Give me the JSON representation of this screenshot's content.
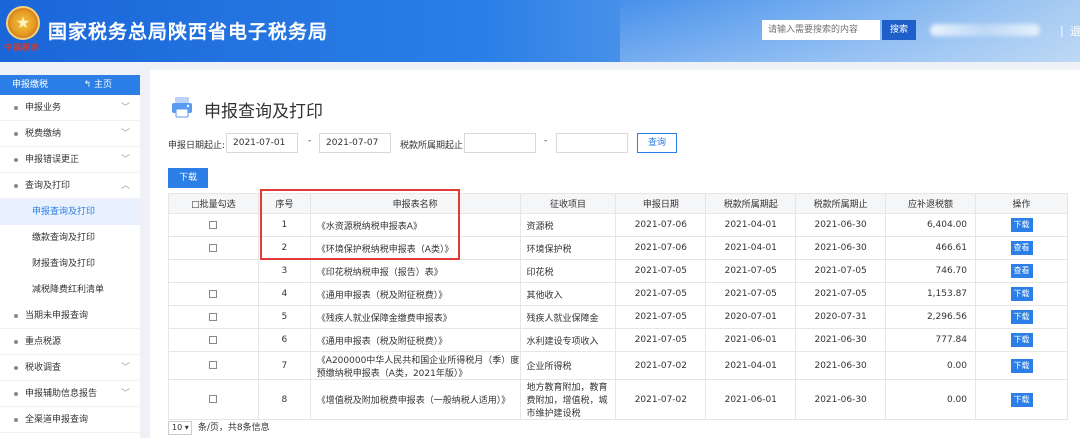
{
  "header": {
    "site_title": "国家税务总局陕西省电子税务局",
    "emblem_text": "中国税务",
    "search_placeholder": "请输入需要搜索的内容",
    "search_button": "搜索",
    "separator": "|",
    "tail_text": "退"
  },
  "sidebar": {
    "head_title": "申报缴税",
    "home_label": "主页",
    "items": [
      {
        "label": "申报业务",
        "chev": "﹀"
      },
      {
        "label": "税费缴纳",
        "chev": "﹀"
      },
      {
        "label": "申报错误更正",
        "chev": "﹀"
      },
      {
        "label": "查询及打印",
        "chev": "︿"
      }
    ],
    "subitems": [
      {
        "label": "申报查询及打印"
      },
      {
        "label": "缴款查询及打印"
      },
      {
        "label": "财报查询及打印"
      },
      {
        "label": "减税降费红利清单"
      }
    ],
    "items_after": [
      {
        "label": "当期未申报查询",
        "chev": ""
      },
      {
        "label": "重点税源",
        "chev": ""
      },
      {
        "label": "税收调查",
        "chev": "﹀"
      },
      {
        "label": "申报辅助信息报告",
        "chev": "﹀"
      },
      {
        "label": "全渠道申报查询",
        "chev": ""
      }
    ]
  },
  "main": {
    "page_title": "申报查询及打印",
    "filter": {
      "date_label": "申报日期起止:",
      "date_from": "2021-07-01",
      "date_to": "2021-07-07",
      "dash": "-",
      "period_label": "税款所属期起止:",
      "period_from": "",
      "period_to": "",
      "query_button": "查询"
    },
    "download_button": "下载",
    "table": {
      "headers": [
        "□批量勾选",
        "序号",
        "申报表名称",
        "征收项目",
        "申报日期",
        "税款所属期起",
        "税款所属期止",
        "应补退税额",
        "操作"
      ],
      "rows": [
        {
          "check": true,
          "no": "1",
          "name": "《水资源税纳税申报表A》",
          "item": "资源税",
          "date": "2021-07-06",
          "start": "2021-04-01",
          "end": "2021-06-30",
          "amount": "6,404.00",
          "action": "下载"
        },
        {
          "check": true,
          "no": "2",
          "name": "《环境保护税纳税申报表（A类）》",
          "item": "环境保护税",
          "date": "2021-07-06",
          "start": "2021-04-01",
          "end": "2021-06-30",
          "amount": "466.61",
          "action": "查看"
        },
        {
          "check": false,
          "no": "3",
          "name": "《印花税纳税申报（报告）表》",
          "item": "印花税",
          "date": "2021-07-05",
          "start": "2021-07-05",
          "end": "2021-07-05",
          "amount": "746.70",
          "action": "查看"
        },
        {
          "check": true,
          "no": "4",
          "name": "《通用申报表（税及附征税费）》",
          "item": "其他收入",
          "date": "2021-07-05",
          "start": "2021-07-05",
          "end": "2021-07-05",
          "amount": "1,153.87",
          "action": "下载"
        },
        {
          "check": true,
          "no": "5",
          "name": "《残疾人就业保障金缴费申报表》",
          "item": "残疾人就业保障金",
          "date": "2021-07-05",
          "start": "2020-07-01",
          "end": "2020-07-31",
          "amount": "2,296.56",
          "action": "下载"
        },
        {
          "check": true,
          "no": "6",
          "name": "《通用申报表（税及附征税费）》",
          "item": "水利建设专项收入",
          "date": "2021-07-05",
          "start": "2021-06-01",
          "end": "2021-06-30",
          "amount": "777.84",
          "action": "下载"
        },
        {
          "check": true,
          "no": "7",
          "name": "《A200000中华人民共和国企业所得税月（季）度预缴纳税申报表（A类，2021年版）》",
          "item": "企业所得税",
          "date": "2021-07-02",
          "start": "2021-04-01",
          "end": "2021-06-30",
          "amount": "0.00",
          "action": "下载"
        },
        {
          "check": true,
          "no": "8",
          "name": "《增值税及附加税费申报表（一般纳税人适用）》",
          "item": "地方教育附加，教育费附加，增值税，城市维护建设税",
          "date": "2021-07-02",
          "start": "2021-06-01",
          "end": "2021-06-30",
          "amount": "0.00",
          "action": "下载"
        }
      ]
    },
    "pager": {
      "page_size": "10",
      "summary": "条/页，共8条信息"
    }
  },
  "colors": {
    "primary": "#2b7fe6",
    "highlight": "#e53935"
  }
}
